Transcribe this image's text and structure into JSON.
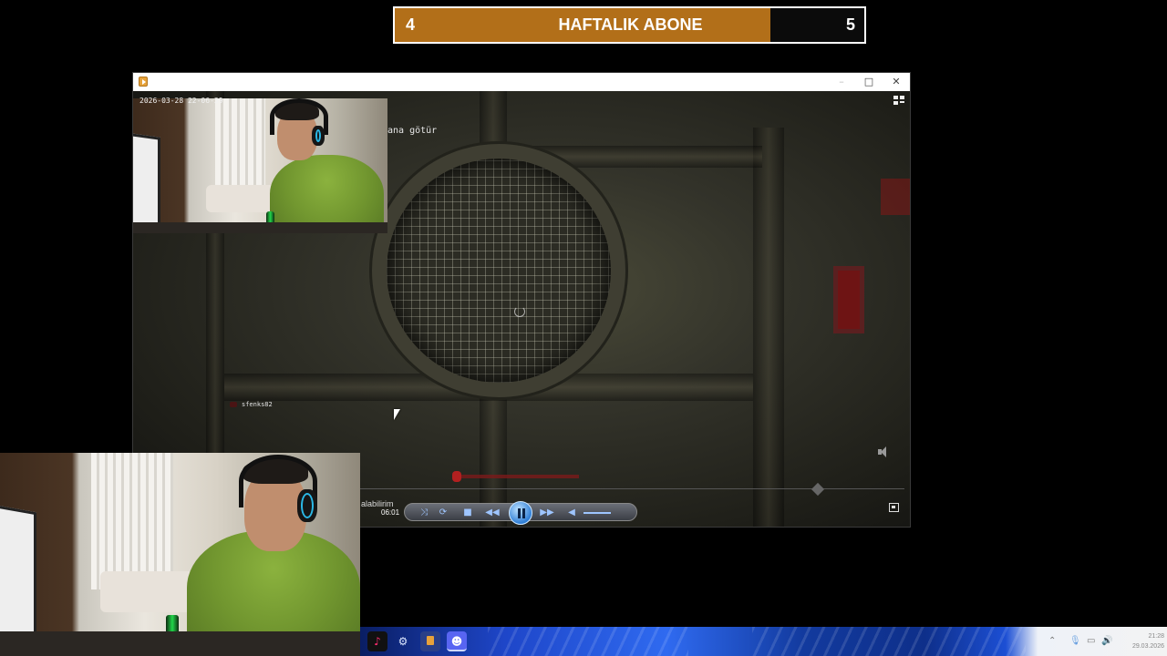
{
  "subscriber_goal": {
    "current": "4",
    "title": "HAFTALIK ABONE",
    "goal": "5",
    "progress_fraction": 0.8,
    "fill_color": "#b26f19"
  },
  "player": {
    "window_controls": {
      "minimize": "–",
      "maximize": "□",
      "close": "✕"
    },
    "timestamp": "2026-03-28 22-06-39",
    "hud_text": "ana götür",
    "player_name": "sfenks82",
    "status_text": "alabilirim",
    "time": "06:01",
    "controls": {
      "shuffle": "⤨",
      "repeat": "⟳",
      "stop": "■",
      "previous": "◀◀",
      "next": "▶▶",
      "mute": "◀"
    }
  },
  "taskbar": {
    "apps": [
      {
        "name": "TikTok",
        "icon": "♪"
      },
      {
        "name": "Steam",
        "icon": "⚙"
      },
      {
        "name": "Media Player",
        "icon": ""
      },
      {
        "name": "Discord",
        "icon": "☻"
      }
    ],
    "tray": {
      "chevron": "⌃",
      "mic": "🎙",
      "network": "▭",
      "speaker": "🔊"
    },
    "clock_time": "21:28",
    "clock_date": "29.03.2026"
  }
}
